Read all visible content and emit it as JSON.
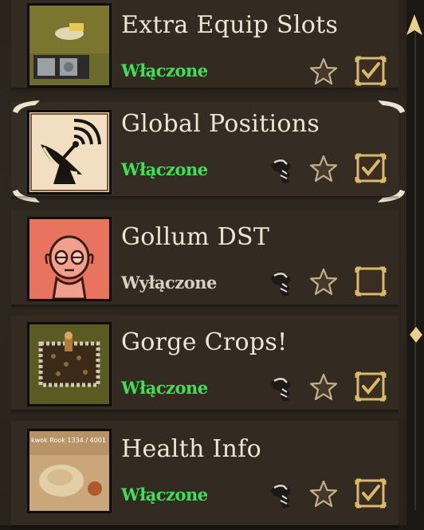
{
  "mods": [
    {
      "name": "Extra Equip Slots",
      "status": "Włączone",
      "enabled": true,
      "has_bolt": false,
      "thumb_icon": "extra-equip-slots-thumbnail"
    },
    {
      "name": "Global Positions",
      "status": "Włączone",
      "enabled": true,
      "has_bolt": true,
      "thumb_icon": "satellite-dish-thumbnail"
    },
    {
      "name": "Gollum DST",
      "status": "Wyłączone",
      "enabled": false,
      "has_bolt": true,
      "thumb_icon": "gollum-face-thumbnail"
    },
    {
      "name": "Gorge Crops!",
      "status": "Włączone",
      "enabled": true,
      "has_bolt": true,
      "thumb_icon": "garden-crops-thumbnail"
    },
    {
      "name": "Health Info",
      "status": "Włączone",
      "enabled": true,
      "has_bolt": true,
      "thumb_icon": "health-info-thumbnail",
      "thumb_text": "kwok Rook 1334 / 4001"
    }
  ],
  "colors": {
    "enabled": "#3fe058",
    "disabled": "#d8d0c0",
    "title": "#eee6d4",
    "accent": "#d8ba6a"
  }
}
